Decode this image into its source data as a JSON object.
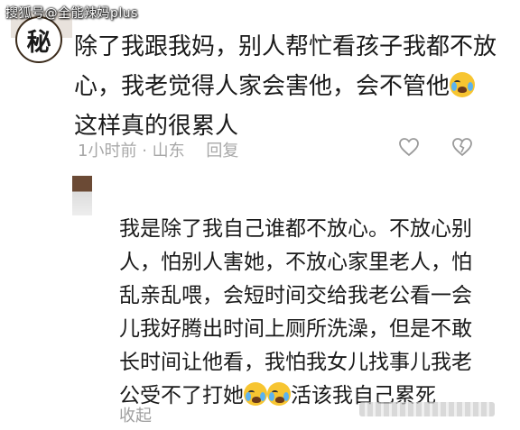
{
  "watermark": "搜狐号@全能辣妈plus",
  "comment1": {
    "avatar_glyph": "秘",
    "text_part1": "除了我跟我妈，别人帮忙看孩子我都不放心，我老觉得人家会害他，会不管他",
    "emoji": "loudly-crying-face",
    "text_part2": "这样真的很累人",
    "time": "1小时前",
    "separator": "·",
    "location": "山东",
    "reply_label": "回复"
  },
  "comment2": {
    "text_part1": "我是除了我自己谁都不放心。不放心别人，怕别人害她，不放心家里老人，怕乱亲乱喂，会短时间交给我老公看一会儿我好腾出时间上厕所洗澡，但是不敢长时间让他看，我怕我女儿找事儿我老公受不了打她",
    "emoji": "loudly-crying-face",
    "text_part2": "活该我自己累死",
    "collapse_label": "收起"
  },
  "colors": {
    "text": "#1a1a1a",
    "meta": "#a8a8a8",
    "emoji": "#f7c531"
  }
}
